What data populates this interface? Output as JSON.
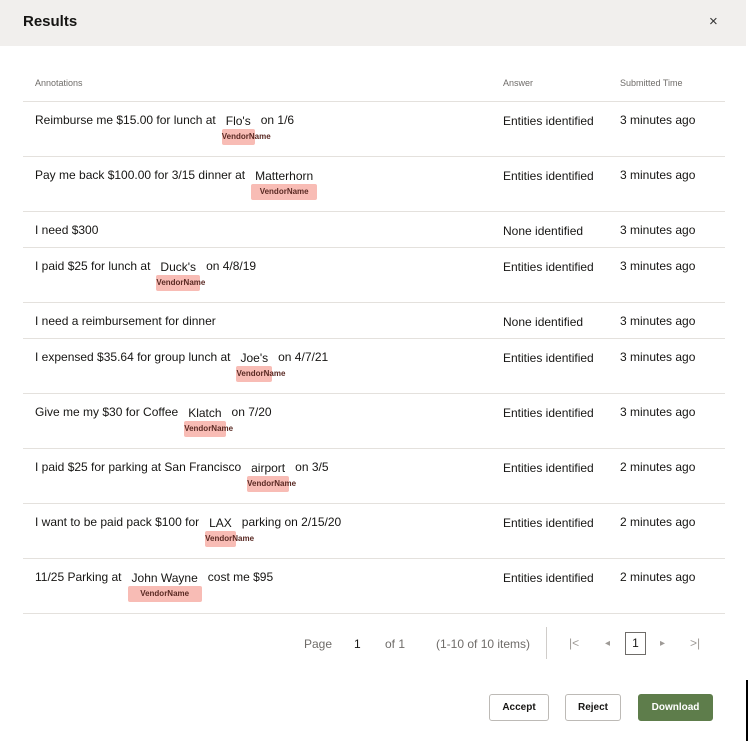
{
  "dialog": {
    "title": "Results",
    "close_icon": "×"
  },
  "table": {
    "headers": {
      "annotations": "Annotations",
      "answer": "Answer",
      "submitted": "Submitted Time"
    },
    "entity_label": "VendorName",
    "rows": [
      {
        "pre": "Reimburse me $15.00 for lunch at",
        "entity": "Flo's",
        "post": "on 1/6",
        "answer": "Entities identified",
        "time": "3 minutes ago"
      },
      {
        "pre": "Pay me back $100.00 for 3/15 dinner at",
        "entity": "Matterhorn",
        "post": "",
        "answer": "Entities identified",
        "time": "3 minutes ago"
      },
      {
        "pre": "I need $300",
        "entity": null,
        "post": "",
        "answer": "None identified",
        "time": "3 minutes ago"
      },
      {
        "pre": "I paid $25 for lunch at",
        "entity": "Duck's",
        "post": "on 4/8/19",
        "answer": "Entities identified",
        "time": "3 minutes ago"
      },
      {
        "pre": "I need a reimbursement for dinner",
        "entity": null,
        "post": "",
        "answer": "None identified",
        "time": "3 minutes ago"
      },
      {
        "pre": "I expensed $35.64 for group lunch at",
        "entity": "Joe's",
        "post": "on 4/7/21",
        "answer": "Entities identified",
        "time": "3 minutes ago"
      },
      {
        "pre": "Give me my $30 for Coffee",
        "entity": "Klatch",
        "post": "on 7/20",
        "answer": "Entities identified",
        "time": "3 minutes ago"
      },
      {
        "pre": "I paid $25 for parking at San Francisco",
        "entity": "airport",
        "post": "on 3/5",
        "answer": "Entities identified",
        "time": "2 minutes ago"
      },
      {
        "pre": "I want to be paid pack $100 for",
        "entity": "LAX",
        "post": "parking on 2/15/20",
        "answer": "Entities identified",
        "time": "2 minutes ago"
      },
      {
        "pre": "11/25 Parking at",
        "entity": "John Wayne",
        "post": "cost me $95",
        "answer": "Entities identified",
        "time": "2 minutes ago"
      }
    ]
  },
  "pagination": {
    "page_label": "Page",
    "page_value": "1",
    "of_label": "of 1",
    "items_label": "(1-10 of 10 items)",
    "current_page": "1",
    "first_icon": "|<",
    "prev_icon": "◂",
    "next_icon": "▸",
    "last_icon": ">|"
  },
  "actions": {
    "accept": "Accept",
    "reject": "Reject",
    "download": "Download"
  },
  "colors": {
    "entity_tag": "#f8bcb5",
    "primary_button": "#5e7d4b",
    "header_bg": "#f1efed"
  }
}
